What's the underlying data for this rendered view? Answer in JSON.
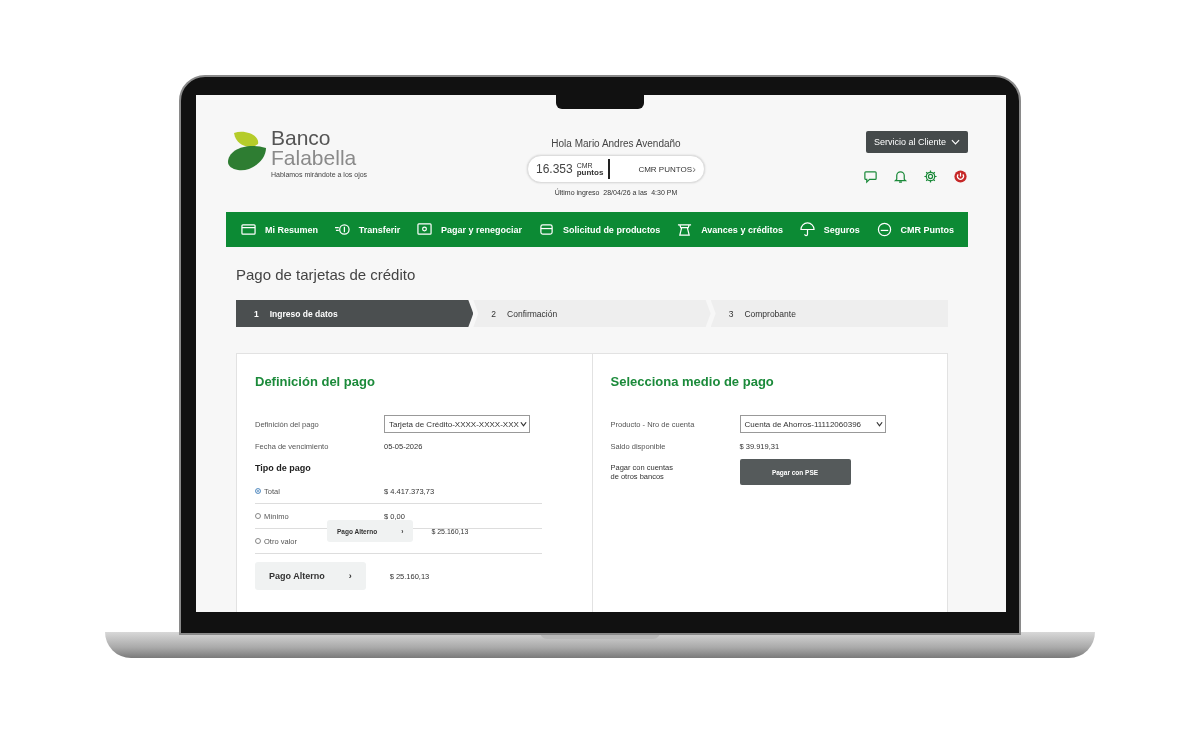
{
  "header": {
    "logo": {
      "line1": "Banco",
      "line2": "Falabella",
      "tagline": "Hablamos mirándote a los ojos"
    },
    "greeting": "Hola Mario Andres Avendaño",
    "points": {
      "value": "16.353",
      "unit_top": "CMR",
      "unit_bottom": "puntos",
      "label": "CMR PUNTOS",
      "arrow": "›"
    },
    "last_login": "Último ingreso  28/04/26 a las  4:30 PM",
    "service_button": "Servicio al Cliente"
  },
  "nav": [
    {
      "label": "Mi Resumen"
    },
    {
      "label": "Transferir"
    },
    {
      "label": "Pagar y renegociar"
    },
    {
      "label": "Solicitud de productos"
    },
    {
      "label": "Avances y créditos"
    },
    {
      "label": "Seguros"
    },
    {
      "label": "CMR Puntos"
    }
  ],
  "page_title": "Pago de tarjetas de crédito",
  "steps": [
    {
      "number": "1",
      "label": "Ingreso de datos",
      "selected": true
    },
    {
      "number": "2",
      "label": "Confirmación",
      "selected": false
    },
    {
      "number": "3",
      "label": "Comprobante",
      "selected": false
    }
  ],
  "payment_definition": {
    "title": "Definición del pago",
    "fields": [
      {
        "kind": "select",
        "label": "Definición del pago",
        "value": "Tarjeta de Crédito-XXXX-XXXX-XXX"
      },
      {
        "kind": "text",
        "label": "Fecha de vencimiento",
        "value": "05-05-2026"
      }
    ],
    "payment_type_title": "Tipo de pago",
    "options": [
      {
        "label": "Total",
        "amount": "$ 4.417.373,73",
        "selected": true
      },
      {
        "label": "Mínimo",
        "amount": "$ 0,00",
        "selected": false
      },
      {
        "label": "Otro valor",
        "selected": false
      }
    ],
    "floating_alternate": {
      "button": "Pago Alterno",
      "arrow": "›",
      "amount": "$ 25.160,13"
    },
    "alternate": {
      "button": "Pago Alterno",
      "arrow": "›",
      "amount": "$ 25.160,13"
    }
  },
  "payment_method": {
    "title": "Selecciona medio de pago",
    "fields": [
      {
        "kind": "select",
        "label": "Producto - Nro de cuenta",
        "value": "Cuenta de Ahorros-11112060396"
      },
      {
        "kind": "text",
        "label": "Saldo disponible",
        "value": "$ 39.919,31"
      }
    ],
    "other_banks_label": "Pagar con cuentas\nde otros bancos",
    "pse_button": "Pagar con PSE"
  }
}
